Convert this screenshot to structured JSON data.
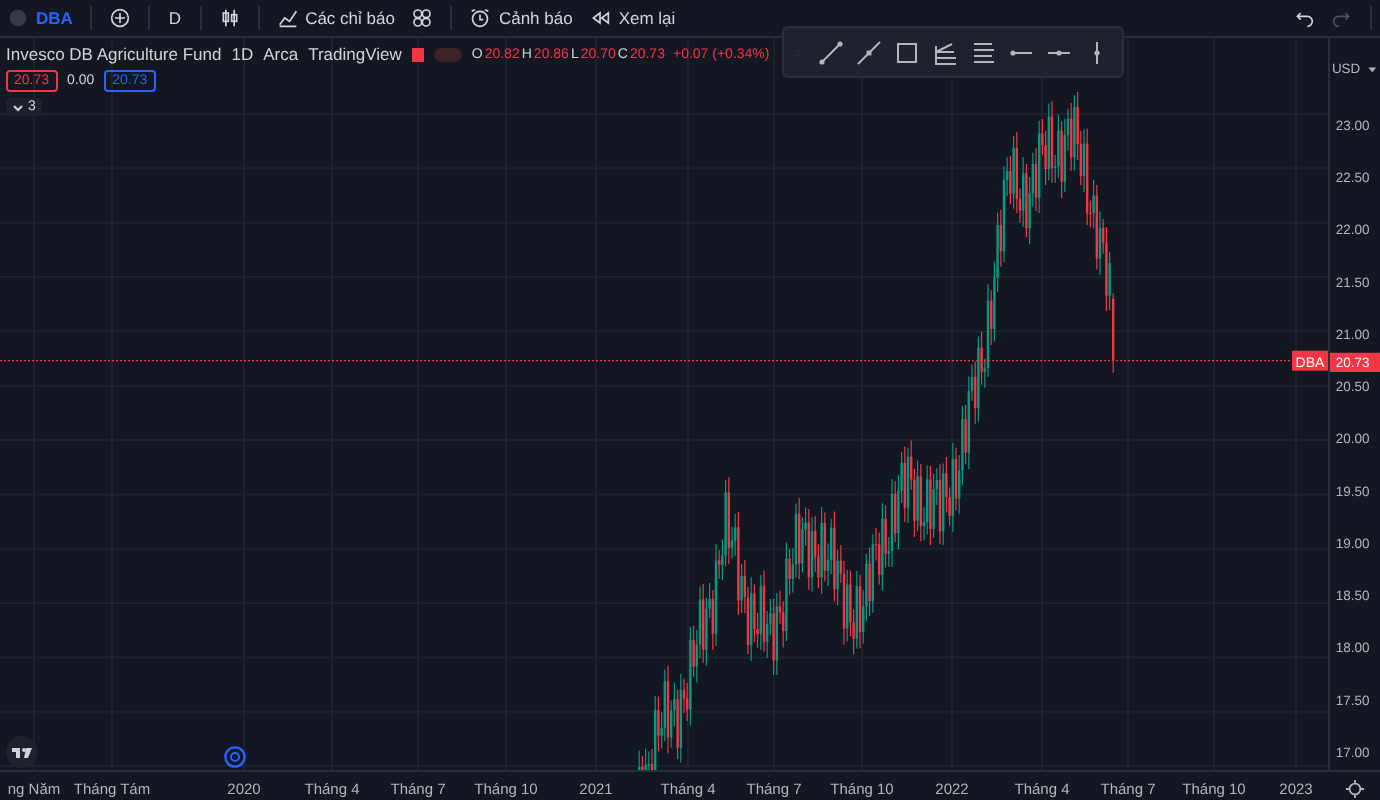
{
  "toolbar": {
    "symbol": "DBA",
    "interval": "D",
    "indicators_label": "Các chỉ báo",
    "alerts_label": "Cảnh báo",
    "replay_label": "Xem lại"
  },
  "legend": {
    "title": "Invesco DB Agriculture Fund",
    "interval": "1D",
    "exchange": "Arca",
    "source": "TradingView",
    "ohlc": [
      {
        "key": "O",
        "value": "20.82"
      },
      {
        "key": "H",
        "value": "20.86"
      },
      {
        "key": "L",
        "value": "20.70"
      },
      {
        "key": "C",
        "value": "20.73"
      }
    ],
    "change": "+0.07 (+0.34%)"
  },
  "order_prices": {
    "sell": "20.73",
    "spread": "0.00",
    "buy": "20.73"
  },
  "indicators_collapsed": {
    "count": "3"
  },
  "price_axis": {
    "currency": "USD",
    "ticks": [
      "23.00",
      "22.50",
      "22.00",
      "21.50",
      "21.00",
      "20.50",
      "20.00",
      "19.50",
      "19.00",
      "18.50",
      "18.00",
      "17.50",
      "17.00"
    ],
    "last_price": {
      "symbol": "DBA",
      "value": "20.73"
    }
  },
  "time_axis": {
    "labels": [
      "ng Năm",
      "Tháng Tám",
      "2020",
      "Tháng 4",
      "Tháng 7",
      "Tháng 10",
      "2021",
      "Tháng 4",
      "Tháng 7",
      "Tháng 10",
      "2022",
      "Tháng 4",
      "Tháng 7",
      "Tháng 10",
      "2023"
    ]
  }
}
